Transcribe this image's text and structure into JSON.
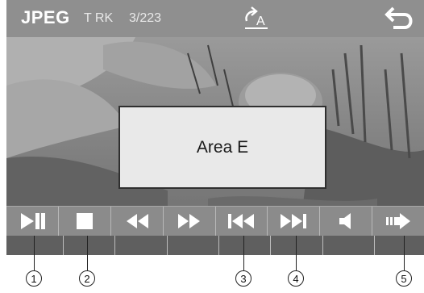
{
  "header": {
    "format_label": "JPEG",
    "track_label": "T RK",
    "track_counter": "3/223",
    "repeat_icon": "repeat-all-icon",
    "back_icon": "back-arrow-icon"
  },
  "area_label": "Area E",
  "controls": [
    {
      "icon": "play-pause-icon"
    },
    {
      "icon": "stop-icon"
    },
    {
      "icon": "fast-rewind-icon"
    },
    {
      "icon": "fast-forward-icon"
    },
    {
      "icon": "previous-track-icon"
    },
    {
      "icon": "next-track-icon"
    },
    {
      "icon": "volume-icon"
    },
    {
      "icon": "slideshow-icon"
    }
  ],
  "callouts": [
    "1",
    "2",
    "3",
    "4",
    "5"
  ],
  "colors": {
    "bar": "#8f8f8f",
    "text": "#ffffff",
    "box": "#e9e9e9"
  }
}
